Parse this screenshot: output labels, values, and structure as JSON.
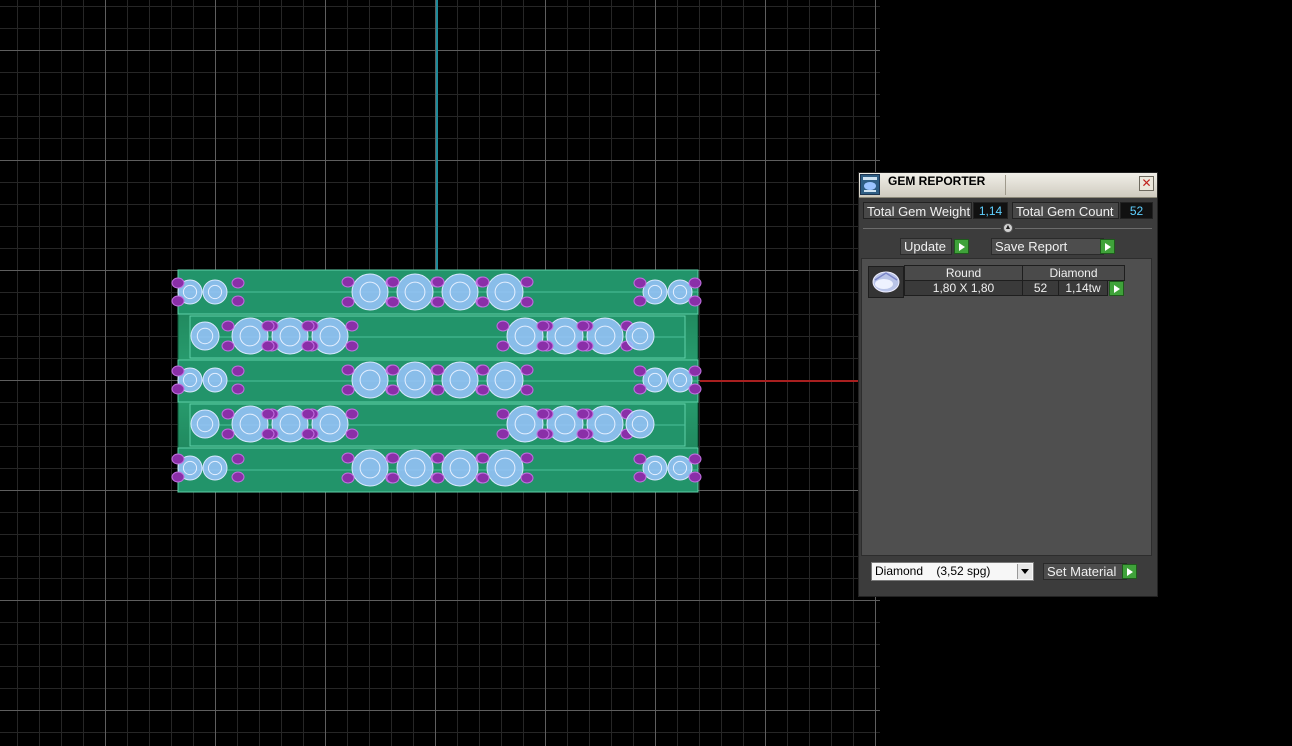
{
  "panel": {
    "title": "GEM REPORTER",
    "close_glyph": "✕",
    "total_weight_label": "Total Gem Weight",
    "total_weight_value": "1,14",
    "total_count_label": "Total Gem Count",
    "total_count_value": "52",
    "update_label": "Update",
    "save_report_label": "Save Report",
    "table": {
      "headers": [
        "Round",
        "Diamond"
      ],
      "row": {
        "size": "1,80 X 1,80",
        "count": "52",
        "weight": "1,14tw"
      }
    },
    "material_select": {
      "value": "Diamond    (3,52 spg)"
    },
    "set_material_label": "Set Material"
  },
  "icons": {
    "panel_icon": "gem-reporter-app-icon",
    "gem_thumbnail": "round-gem-icon",
    "close": "close-icon",
    "arrow": "play-arrow-icon",
    "dropdown": "chevron-down-icon"
  },
  "colors": {
    "y_axis": "#1f8a9a",
    "x_axis": "#a81f1f",
    "metal": "#1e8a5a",
    "gem": "#9bc4ff",
    "prong": "#8a2fa8",
    "value_text": "#5fd0ff",
    "action_button": "#3fa23a"
  }
}
